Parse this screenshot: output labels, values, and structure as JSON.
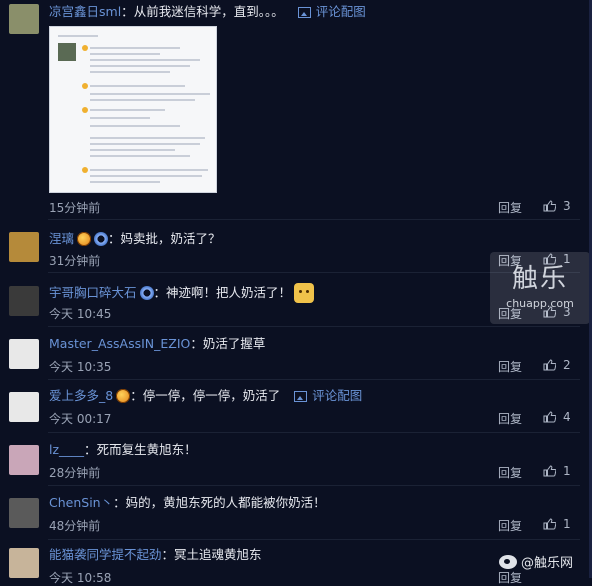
{
  "labels": {
    "reply": "回复"
  },
  "watermark": {
    "big": "触乐",
    "small": "chuapp.com"
  },
  "footer_watermark": "@触乐网",
  "comments": [
    {
      "user": "凉宫鑫日sml",
      "sep": "：",
      "text": "从前我迷信科学，直到。。。",
      "pic_link": "评论配图",
      "time": "15分钟前",
      "likes": "3",
      "avatar_color": "#8a8f6a"
    },
    {
      "user": "涅璃",
      "sep": "：",
      "text": "妈卖批，奶活了？",
      "time": "31分钟前",
      "likes": "1",
      "avatar_color": "#b58a3a"
    },
    {
      "user": "宇哥胸口碎大石",
      "sep": "：",
      "text": "神迹啊！把人奶活了！",
      "time": "今天 10:45",
      "likes": "3",
      "avatar_color": "#3a3a3a"
    },
    {
      "user": "Master_AssAssIN_EZIO",
      "sep": "：",
      "text": "奶活了握草",
      "time": "今天 10:35",
      "likes": "2",
      "avatar_color": "#e8e8e8"
    },
    {
      "user": "爱上多多_8",
      "sep": "：",
      "text": "停一停，停一停，奶活了",
      "pic_link": "评论配图",
      "time": "今天 00:17",
      "likes": "4",
      "avatar_color": "#e8e8e8"
    },
    {
      "user": "lz____",
      "sep": "：",
      "text": "死而复生黄旭东！",
      "time": "28分钟前",
      "likes": "1",
      "avatar_color": "#c9a6b8"
    },
    {
      "user": "ChenSin丶",
      "sep": "：",
      "text": "妈的，黄旭东死的人都能被你奶活！",
      "time": "48分钟前",
      "likes": "1",
      "avatar_color": "#5a5a5a"
    },
    {
      "user": "能猫袭同学提不起劲",
      "sep": "：",
      "text": "冥土追魂黄旭东",
      "time": "今天 10:58",
      "likes": "",
      "avatar_color": "#c7b49a"
    }
  ]
}
